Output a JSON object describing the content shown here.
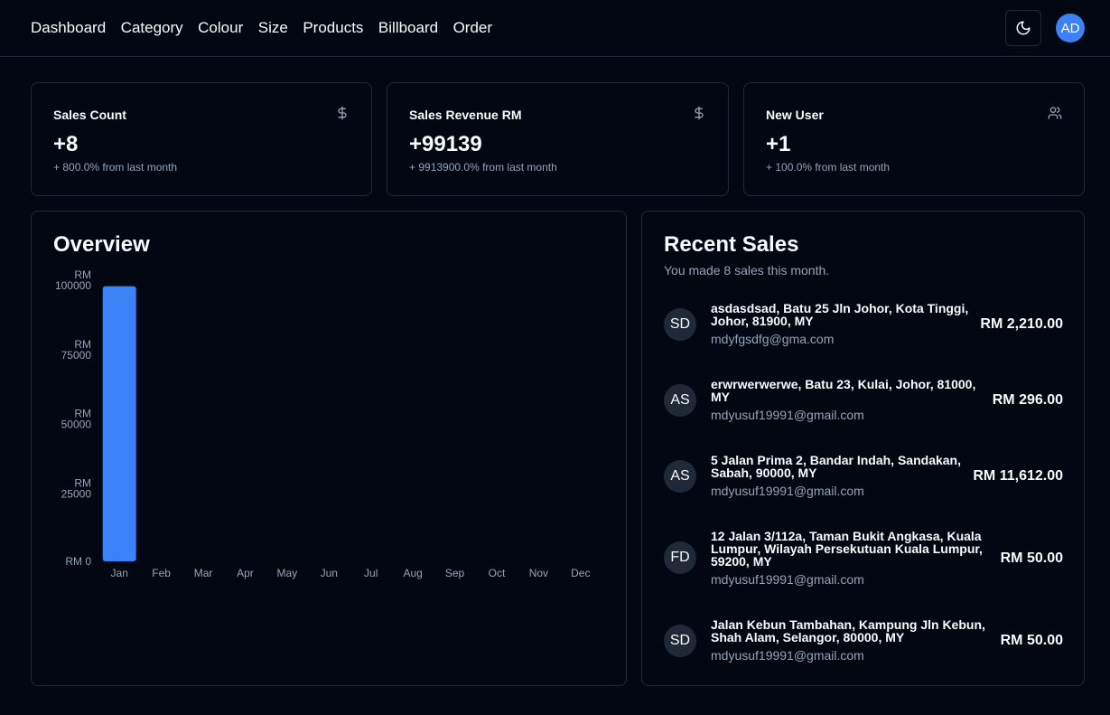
{
  "nav": {
    "items": [
      {
        "label": "Dashboard"
      },
      {
        "label": "Category"
      },
      {
        "label": "Colour"
      },
      {
        "label": "Size"
      },
      {
        "label": "Products"
      },
      {
        "label": "Billboard"
      },
      {
        "label": "Order"
      }
    ],
    "theme_icon": "moon-icon",
    "avatar": "AD"
  },
  "stats": [
    {
      "title": "Sales Count",
      "icon": "dollar-icon",
      "value": "+8",
      "sub": "+ 800.0% from last month"
    },
    {
      "title": "Sales Revenue RM",
      "icon": "dollar-icon",
      "value": "+99139",
      "sub": "+ 9913900.0% from last month"
    },
    {
      "title": "New User",
      "icon": "users-icon",
      "value": "+1",
      "sub": "+ 100.0% from last month"
    }
  ],
  "overview": {
    "title": "Overview"
  },
  "chart_data": {
    "type": "bar",
    "title": "Overview",
    "categories": [
      "Jan",
      "Feb",
      "Mar",
      "Apr",
      "May",
      "Jun",
      "Jul",
      "Aug",
      "Sep",
      "Oct",
      "Nov",
      "Dec"
    ],
    "values": [
      99139,
      0,
      0,
      0,
      0,
      0,
      0,
      0,
      0,
      0,
      0,
      0
    ],
    "y_ticks": [
      {
        "value": 0,
        "label": "RM 0"
      },
      {
        "value": 25000,
        "label": "RM 25000"
      },
      {
        "value": 50000,
        "label": "RM 50000"
      },
      {
        "value": 75000,
        "label": "RM 75000"
      },
      {
        "value": 100000,
        "label": "RM 100000"
      }
    ],
    "ylim": [
      0,
      100000
    ],
    "bar_color": "#3b82f6",
    "grid": false
  },
  "recent": {
    "title": "Recent Sales",
    "subtitle": "You made 8 sales this month.",
    "sales": [
      {
        "initials": "SD",
        "name": "asdasdsad, Batu 25 Jln Johor, Kota Tinggi, Johor, 81900, MY",
        "email": "mdyfgsdfg@gma.com",
        "amount": "RM 2,210.00"
      },
      {
        "initials": "AS",
        "name": "erwrwerwerwe, Batu 23, Kulai, Johor, 81000, MY",
        "email": "mdyusuf19991@gmail.com",
        "amount": "RM 296.00"
      },
      {
        "initials": "AS",
        "name": "5 Jalan Prima 2, Bandar Indah, Sandakan, Sabah, 90000, MY",
        "email": "mdyusuf19991@gmail.com",
        "amount": "RM 11,612.00"
      },
      {
        "initials": "FD",
        "name": "12 Jalan 3/112a, Taman Bukit Angkasa, Kuala Lumpur, Wilayah Persekutuan Kuala Lumpur, 59200, MY",
        "email": "mdyusuf19991@gmail.com",
        "amount": "RM 50.00"
      },
      {
        "initials": "SD",
        "name": "Jalan Kebun Tambahan, Kampung Jln Kebun, Shah Alam, Selangor, 80000, MY",
        "email": "mdyusuf19991@gmail.com",
        "amount": "RM 50.00"
      }
    ]
  }
}
